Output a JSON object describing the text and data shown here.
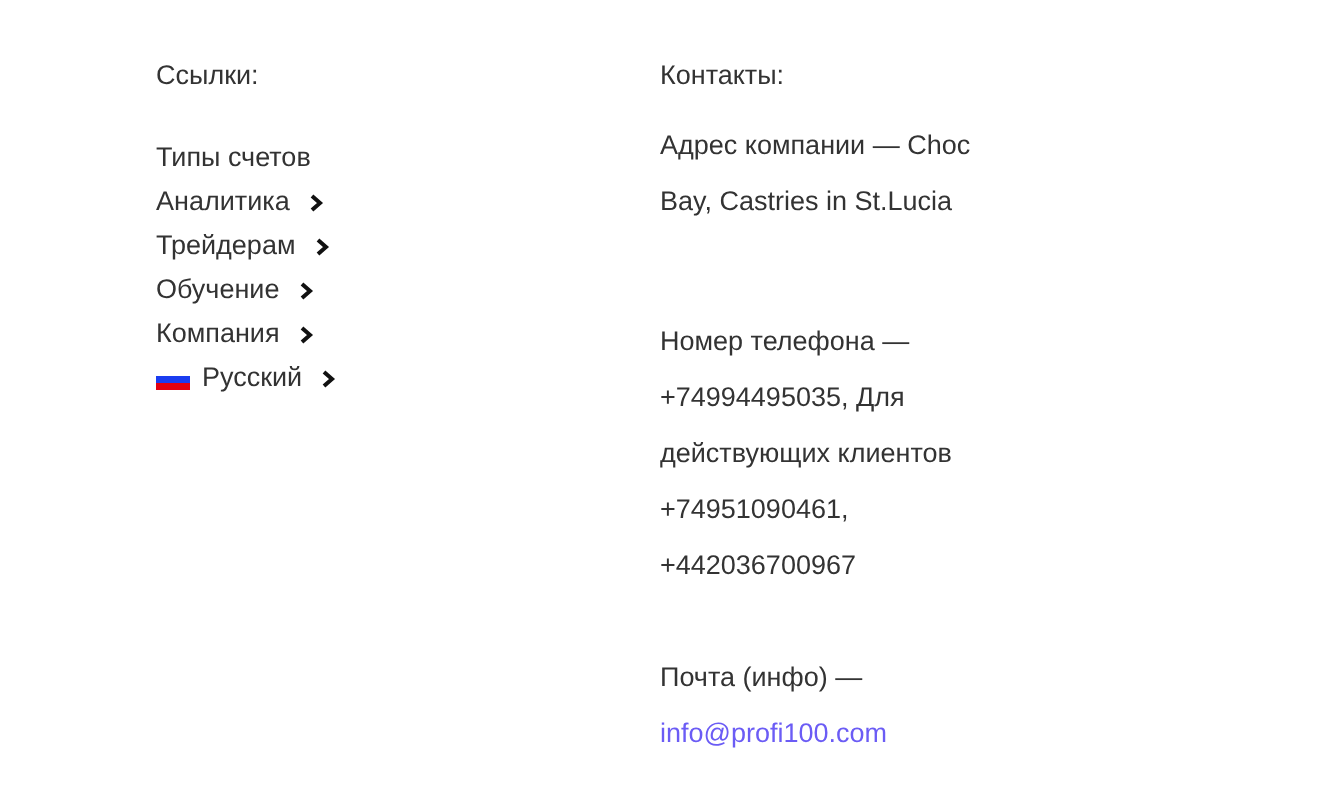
{
  "links": {
    "heading": "Ссылки:",
    "items": [
      {
        "kind": "link",
        "label": "Типы счетов",
        "has_submenu": false
      },
      {
        "kind": "link",
        "label": "Аналитика",
        "has_submenu": true
      },
      {
        "kind": "link",
        "label": "Трейдерам",
        "has_submenu": true
      },
      {
        "kind": "link",
        "label": "Обучение",
        "has_submenu": true
      },
      {
        "kind": "link",
        "label": "Компания",
        "has_submenu": true
      },
      {
        "kind": "language",
        "label": "Русский",
        "has_submenu": true
      }
    ]
  },
  "contacts": {
    "heading": "Контакты:",
    "blocks": [
      {
        "kind": "text",
        "lines": [
          "Адрес компании — Choc",
          "Bay, Castries in St.Lucia"
        ]
      },
      {
        "kind": "text",
        "lines": [
          "Номер телефона —",
          "+74994495035, Для",
          "действующих клиентов",
          "+74951090461,",
          "+442036700967"
        ]
      },
      {
        "kind": "text",
        "lines": [
          "Почта (инфо) —"
        ]
      },
      {
        "kind": "email",
        "lines": [
          "info@profi100.com"
        ]
      }
    ]
  }
}
